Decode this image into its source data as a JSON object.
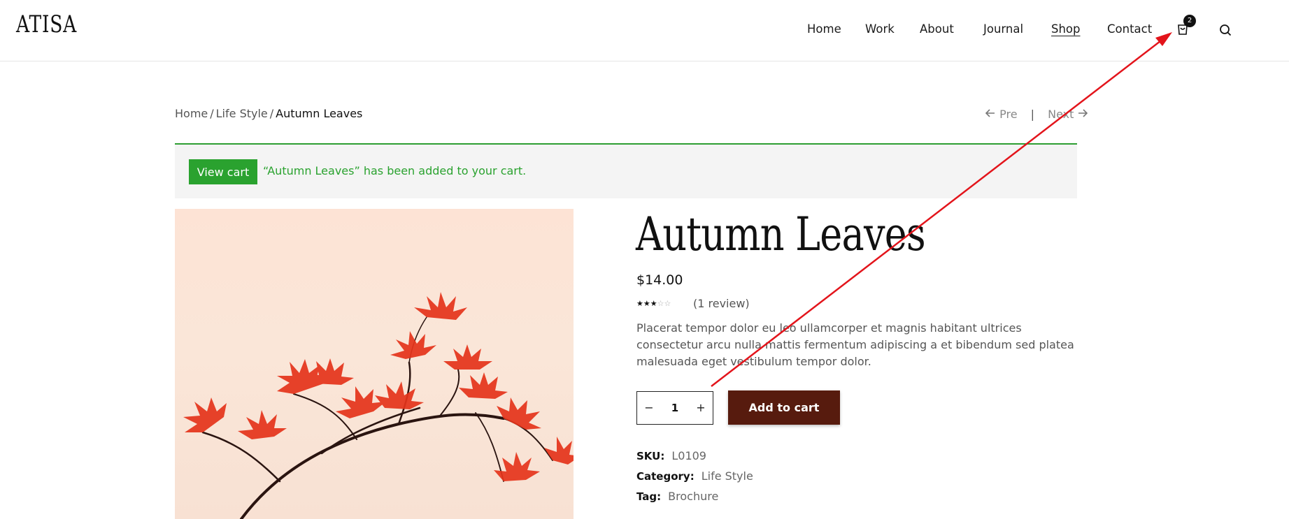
{
  "header": {
    "logo": "ATISA",
    "nav": [
      {
        "label": "Home"
      },
      {
        "label": "Work"
      },
      {
        "label": "About"
      },
      {
        "label": "Journal"
      },
      {
        "label": "Shop",
        "active": true
      },
      {
        "label": "Contact"
      }
    ],
    "cart_count": "2",
    "icons": [
      "cart-icon",
      "search-icon"
    ]
  },
  "breadcrumb": {
    "home": "Home",
    "separator": "/",
    "category": "Life Style",
    "current": "Autumn Leaves"
  },
  "pagination": {
    "prev": "Pre",
    "divider": "|",
    "next": "Next"
  },
  "notice": {
    "button": "View cart",
    "message": "“Autumn Leaves” has been added to your cart.",
    "color": "#2aa22f"
  },
  "product": {
    "title": "Autumn Leaves",
    "price": "$14.00",
    "rating": {
      "value": 3,
      "max": 5
    },
    "review_text": "(1 review)",
    "description": "Placerat tempor dolor eu leo ullamcorper et magnis habitant ultrices consectetur arcu nulla mattis fermentum adipiscing a et bibendum sed platea malesuada eget vestibulum tempor dolor.",
    "quantity": "1",
    "qty_minus": "−",
    "qty_plus": "+",
    "add_to_cart": "Add to cart",
    "add_to_cart_color": "#571b0e",
    "meta": {
      "sku_label": "SKU:",
      "sku": "L0109",
      "category_label": "Category:",
      "category": "Life Style",
      "tag_label": "Tag:",
      "tag": "Brochure"
    }
  },
  "annotation": {
    "type": "arrow",
    "color": "#e3141b"
  }
}
